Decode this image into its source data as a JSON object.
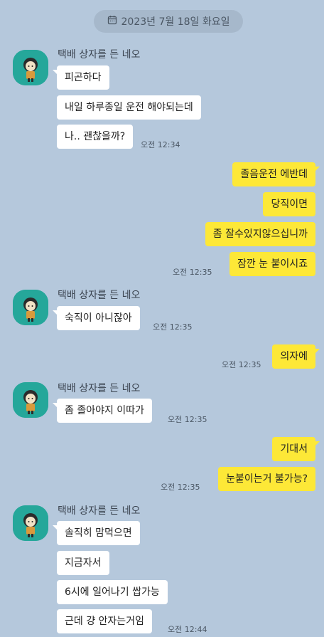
{
  "date_divider": {
    "icon": "calendar-icon",
    "text": "2023년 7월 18일 화요일"
  },
  "contact": {
    "name": "택배 상자를 든 네오",
    "avatar": "neo-avatar"
  },
  "colors": {
    "background": "#b5c8dc",
    "incoming": "#ffffff",
    "outgoing": "#fde837",
    "avatar_bg": "#25a79a"
  },
  "groups": [
    {
      "side": "in",
      "messages": [
        "피곤하다",
        "내일 하루종일 운전 해야되는데",
        "나.. 괜찮을까?"
      ],
      "time": "오전 12:34"
    },
    {
      "side": "out",
      "messages": [
        "졸음운전 에반데",
        "당직이면",
        "좀 잘수있지않으십니까",
        "잠깐 눈 붙이시죠"
      ],
      "time": "오전 12:35"
    },
    {
      "side": "in",
      "messages": [
        "숙직이 아니잖아"
      ],
      "time": "오전 12:35"
    },
    {
      "side": "out",
      "messages": [
        "의자에"
      ],
      "time": "오전 12:35"
    },
    {
      "side": "in",
      "messages": [
        "좀 졸아야지 이따가"
      ],
      "time": "오전 12:35"
    },
    {
      "side": "out",
      "messages": [
        "기대서",
        "눈붙이는거 불가능?"
      ],
      "time": "오전 12:35"
    },
    {
      "side": "in",
      "messages": [
        "솔직히 맘먹으면",
        "지금자서",
        "6시에 일어나기 쌉가능",
        "근데 걍 안자는거임"
      ],
      "time": "오전 12:44"
    }
  ]
}
